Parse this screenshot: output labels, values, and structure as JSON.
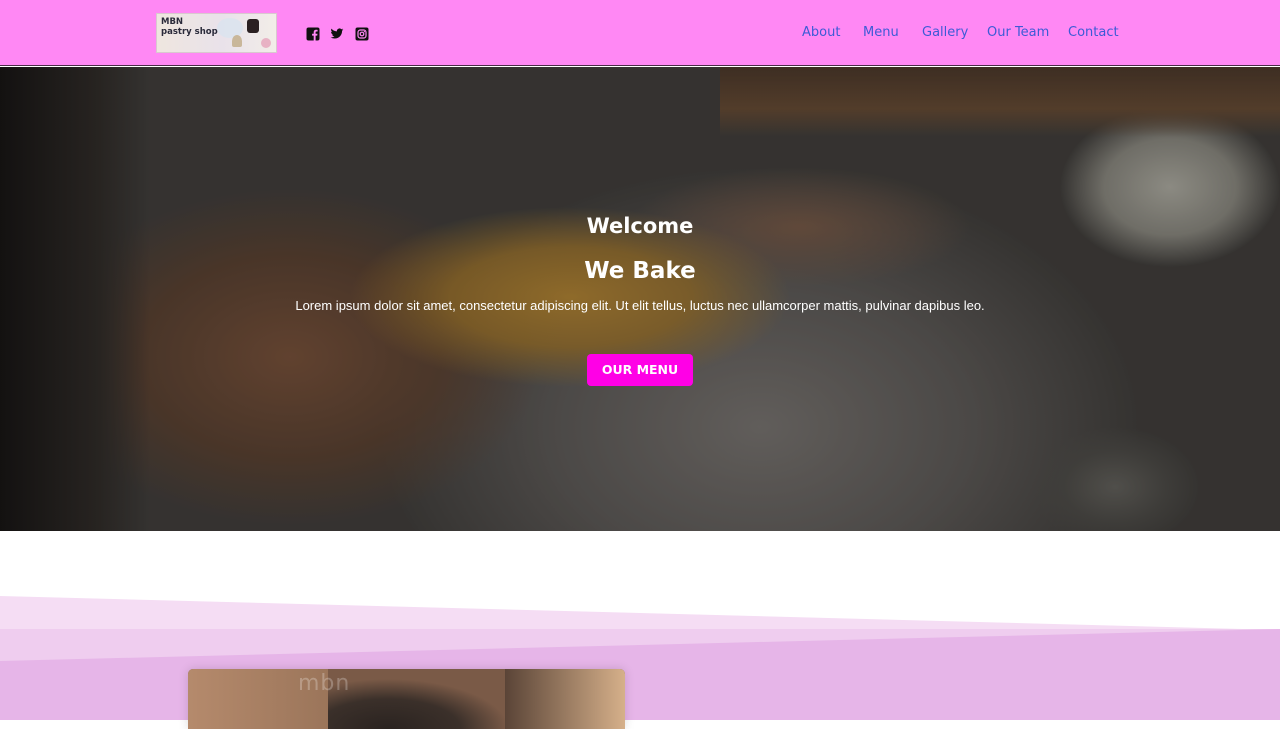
{
  "header": {
    "logo": {
      "line1": "MBN",
      "line2": "pastry shop"
    },
    "social": [
      "facebook-icon",
      "twitter-icon",
      "instagram-icon"
    ],
    "nav": [
      "About",
      "Menu",
      "Gallery",
      "Our Team",
      "Contact"
    ],
    "colors": {
      "background": "#ff88f4",
      "link": "#3d5bd6"
    }
  },
  "hero": {
    "subtitle": "Welcome",
    "title": "We Bake",
    "text": "Lorem ipsum dolor sit amet, consectetur adipiscing elit. Ut elit tellus, luctus nec ullamcorper mattis, pulvinar dapibus leo.",
    "button": "OUR MENU",
    "colors": {
      "button": "#ff00e6"
    }
  },
  "about": {
    "image_text": "mbn"
  }
}
